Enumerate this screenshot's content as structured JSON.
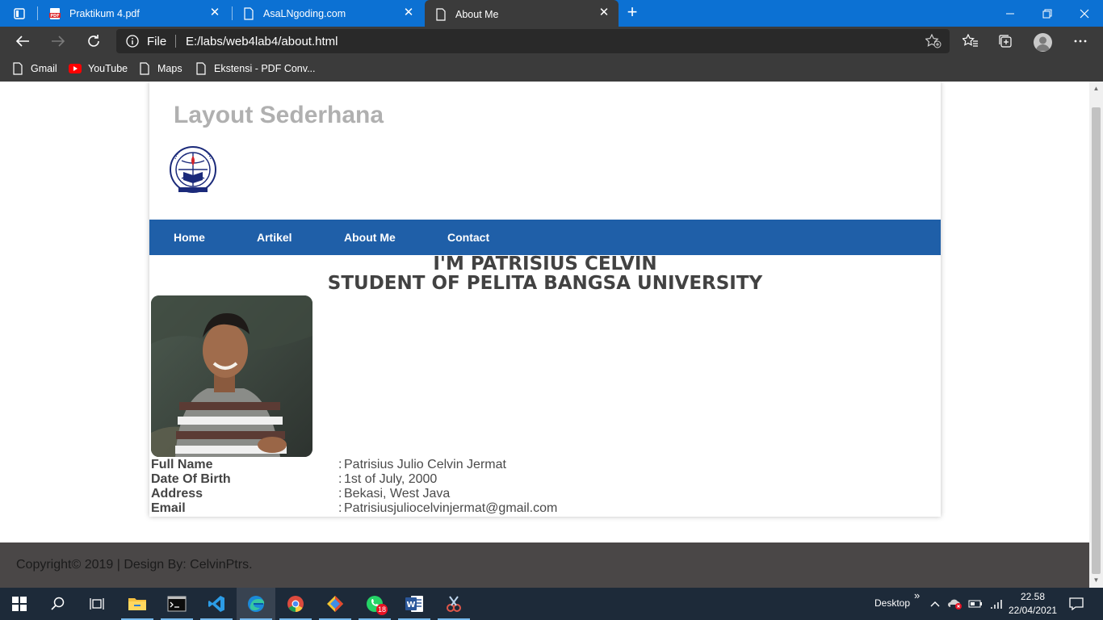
{
  "browser": {
    "tabs": [
      {
        "label": "Praktikum 4.pdf",
        "icon": "pdf-icon",
        "active": false
      },
      {
        "label": "AsaLNgoding.com",
        "icon": "page-icon",
        "active": false
      },
      {
        "label": "About Me",
        "icon": "page-icon",
        "active": true
      }
    ],
    "address": {
      "scheme": "File",
      "url": "E:/labs/web4lab4/about.html"
    },
    "bookmarks": [
      {
        "label": "Gmail",
        "icon": "page-icon"
      },
      {
        "label": "YouTube",
        "icon": "youtube-icon"
      },
      {
        "label": "Maps",
        "icon": "page-icon"
      },
      {
        "label": "Ekstensi - PDF Conv...",
        "icon": "page-icon"
      }
    ]
  },
  "page": {
    "site_title": "Layout Sederhana",
    "nav": [
      "Home",
      "Artikel",
      "About Me",
      "Contact"
    ],
    "headline_1": "I'M PATRISIUS CELVIN",
    "headline_2": "STUDENT OF PELITA BANGSA UNIVERSITY",
    "bio": [
      {
        "label": "Full Name",
        "value": "Patrisius Julio Celvin Jermat"
      },
      {
        "label": "Date Of Birth",
        "value": "1st of July, 2000"
      },
      {
        "label": "Address",
        "value": "Bekasi, West Java"
      },
      {
        "label": "Email",
        "value": "Patrisiusjuliocelvinjermat@gmail.com"
      }
    ],
    "separator": ":",
    "footer": "Copyright© 2019 | Design By: CelvinPtrs."
  },
  "taskbar": {
    "desktop_label": "Desktop",
    "chevron": "»",
    "time": "22.58",
    "date": "22/04/2021",
    "whatsapp_badge": "18"
  },
  "colors": {
    "tab_bar": "#0c71d3",
    "chrome_dark": "#3b3b3b",
    "nav_blue": "#1f5fa8",
    "footer_bg": "#4a4747",
    "taskbar_bg": "#1d2a39"
  }
}
